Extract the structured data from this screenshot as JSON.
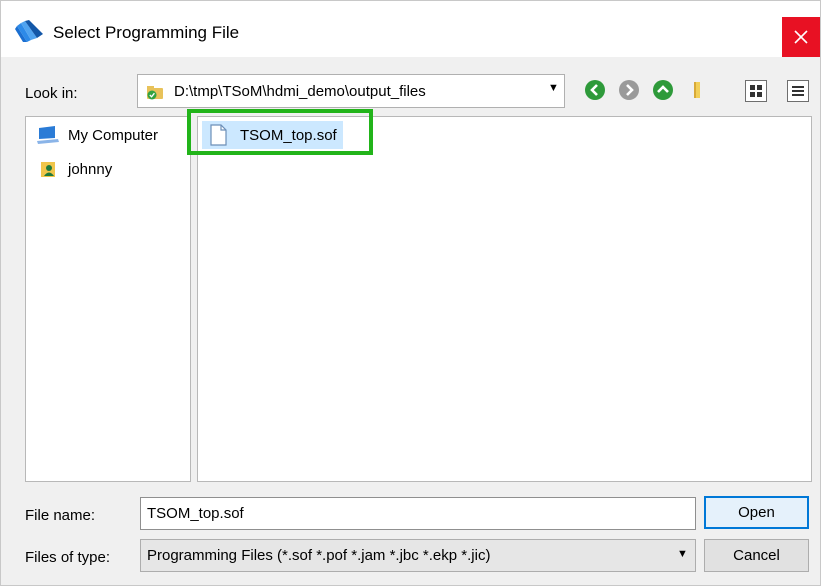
{
  "window": {
    "title": "Select Programming File",
    "colors": {
      "close_bg": "#e81123",
      "selection_bg": "#cce8ff",
      "highlight_box": "#22b41a",
      "default_button_border": "#0078d7"
    }
  },
  "toolbar": {
    "lookin_label": "Look in:",
    "lookin_path": "D:\\tmp\\TSoM\\hdmi_demo\\output_files",
    "icons": [
      "back-icon",
      "forward-icon",
      "up-icon",
      "new-folder-icon",
      "list-view-icon",
      "detail-view-icon"
    ]
  },
  "sidebar": {
    "items": [
      {
        "label": "My Computer",
        "icon": "computer-icon"
      },
      {
        "label": "johnny",
        "icon": "user-folder-icon"
      }
    ]
  },
  "files": [
    {
      "name": "TSOM_top.sof",
      "icon": "file-icon",
      "selected": true
    }
  ],
  "footer": {
    "filename_label": "File name:",
    "filename_value": "TSOM_top.sof",
    "filetype_label": "Files of type:",
    "filetype_value": "Programming Files (*.sof *.pof *.jam *.jbc *.ekp *.jic)",
    "open_label": "Open",
    "cancel_label": "Cancel"
  }
}
